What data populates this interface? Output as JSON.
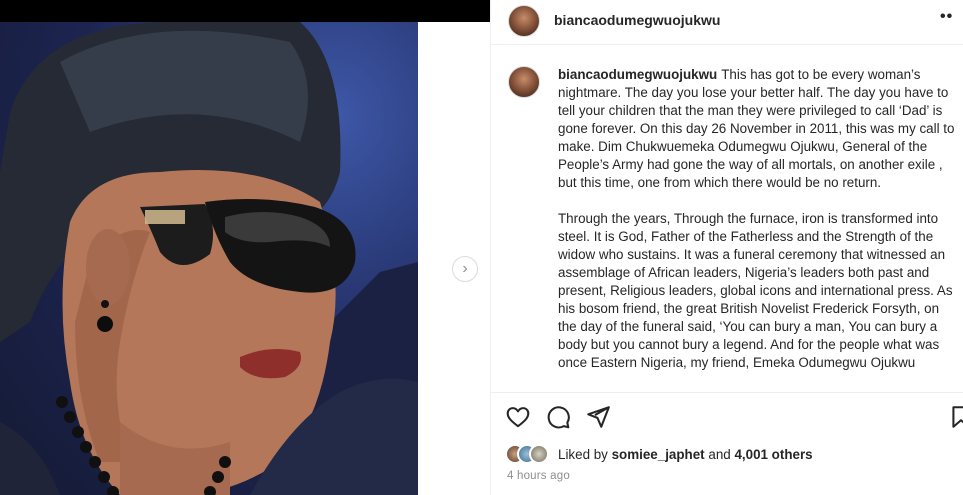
{
  "post": {
    "username": "biancaodumegwuojukwu",
    "more_label": "••",
    "next_label": "›",
    "caption_username": "biancaodumegwuojukwu",
    "caption_p1": "This has got to be every woman’s nightmare. The day you lose your better half. The day you have to tell your children that the man they were privileged to call ‘Dad’ is gone forever. On this day 26 November in 2011, this was my call to make. Dim Chukwuemeka Odumegwu Ojukwu, General of the People’s Army had gone the way of all mortals, on another exile , but this time, one from which there would be no return.",
    "caption_p2": "Through the years, Through the furnace, iron is transformed into steel. It is God, Father of the Fatherless and the Strength of the widow who sustains. It was a funeral ceremony that witnessed an assemblage of African leaders, Nigeria’s leaders both past and present, Religious leaders, global icons and international press. As his bosom friend, the great British Novelist Frederick Forsyth, on the day of the funeral said, ‘You can bury a man, You can bury a body but you cannot bury a legend. And for the people what was once Eastern Nigeria, my friend, Emeka Odumegwu Ojukwu",
    "liked_prefix": "Liked by",
    "liked_user": "somiee_japhet",
    "liked_and": "and",
    "liked_count": "4,001 others",
    "timestamp": "4 hours ago"
  },
  "icons": {
    "like": "heart-icon",
    "comment": "comment-icon",
    "share": "paper-plane-icon",
    "save": "bookmark-icon",
    "next": "chevron-right-icon",
    "more": "more-options-icon"
  }
}
